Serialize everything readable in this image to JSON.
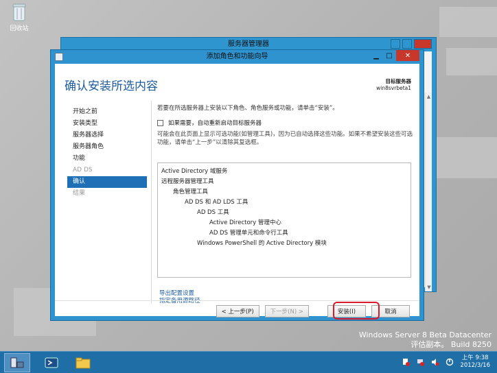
{
  "desktop": {
    "recycle_bin_label": "回收站"
  },
  "background_window": {
    "title": "服务器管理器"
  },
  "wizard": {
    "title": "添加角色和功能向导",
    "page_title": "确认安装所选内容",
    "target_label": "目标服务器",
    "target_server": "win8svrbeta1",
    "nav": [
      {
        "label": "开始之前",
        "state": "normal"
      },
      {
        "label": "安装类型",
        "state": "normal"
      },
      {
        "label": "服务器选择",
        "state": "normal"
      },
      {
        "label": "服务器角色",
        "state": "normal"
      },
      {
        "label": "功能",
        "state": "normal"
      },
      {
        "label": "AD DS",
        "state": "disabled"
      },
      {
        "label": "确认",
        "state": "active"
      },
      {
        "label": "结果",
        "state": "disabled"
      }
    ],
    "intro": "若要在所选服务器上安装以下角色、角色服务或功能，请单击“安装”。",
    "restart_checkbox_label": "如果需要，自动重新启动目标服务器",
    "restart_checked": false,
    "note": "可能会在此页面上显示可选功能(如管理工具)，因为已自动选择这些功能。如果不希望安装这些可选功能，请单击“上一步”以清除其复选框。",
    "items": [
      {
        "text": "Active Directory 域服务",
        "level": 0
      },
      {
        "text": "远程服务器管理工具",
        "level": 0
      },
      {
        "text": "角色管理工具",
        "level": 1
      },
      {
        "text": "AD DS 和 AD LDS 工具",
        "level": 2
      },
      {
        "text": "AD DS 工具",
        "level": 3
      },
      {
        "text": "Active Directory 管理中心",
        "level": 4
      },
      {
        "text": "AD DS 管理单元和命令行工具",
        "level": 4
      },
      {
        "text": "Windows PowerShell 的 Active Directory 模块",
        "level": 3
      }
    ],
    "links": {
      "export": "导出配置设置",
      "alternate_source": "指定备用源路径"
    },
    "buttons": {
      "previous": "< 上一步(P)",
      "next": "下一步(N) >",
      "install": "安装(I)",
      "cancel": "取消"
    }
  },
  "watermark": {
    "line1": "Windows Server 8 Beta Datacenter",
    "line2": "评估副本。 Build 8250"
  },
  "taskbar": {
    "time": "上午 9:38",
    "date": "2012/3/16",
    "accent_color": "#1f6ea6"
  },
  "colors": {
    "window_chrome": "#2e93cf",
    "title_text_blue": "#1c5b9e",
    "active_nav": "#1e6fb5",
    "highlight_ring": "#d9192b"
  }
}
